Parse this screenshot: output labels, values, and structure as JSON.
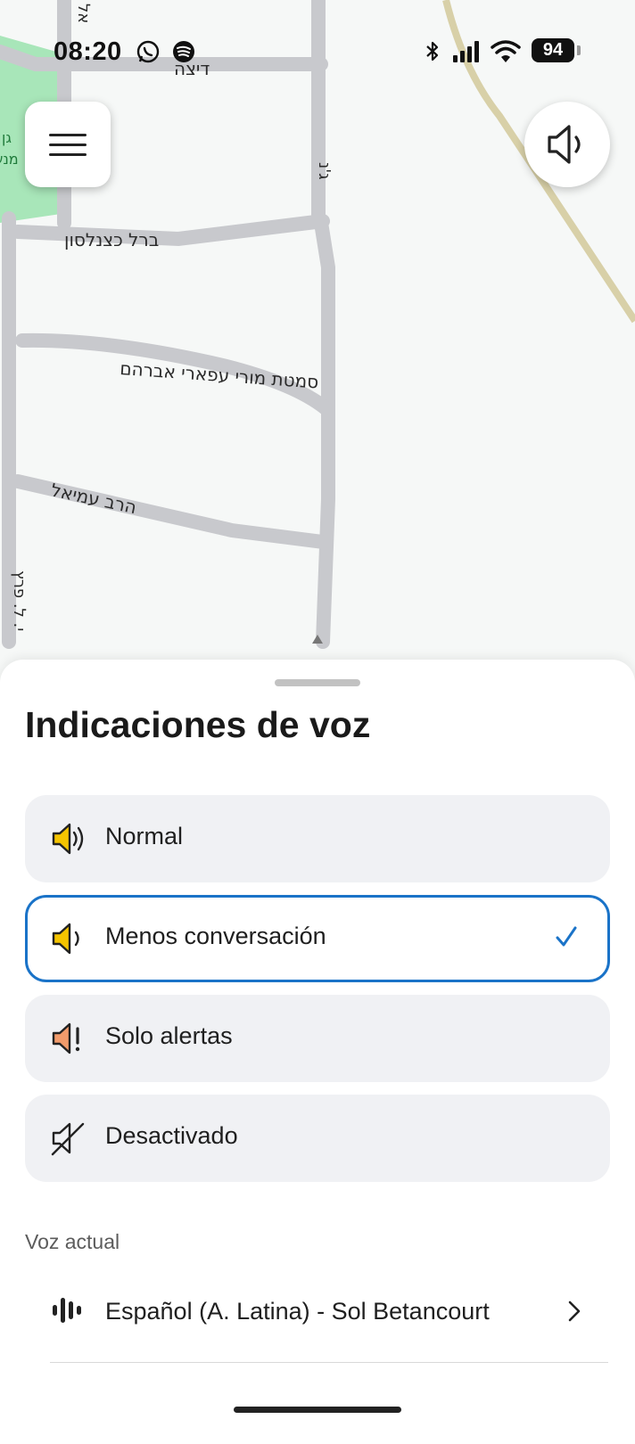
{
  "status_bar": {
    "time": "08:20",
    "battery": "94",
    "icons": [
      "whatsapp-icon",
      "spotify-icon",
      "bluetooth-icon",
      "cell-signal-icon",
      "wifi-icon",
      "battery-icon"
    ]
  },
  "map": {
    "streets": [
      "דיצה",
      "ברל כצנלסון",
      "סמטת מורי עפארי אברהם",
      "הרב עמיאל",
      "ג'נ",
      "אל",
      "י. ל. פרץ"
    ],
    "park_label": [
      "גן",
      "מנש"
    ]
  },
  "controls": {
    "menu_icon": "hamburger-menu-icon",
    "sound_icon": "speaker-reduced-icon"
  },
  "sheet": {
    "title": "Indicaciones de voz",
    "options": [
      {
        "label": "Normal",
        "icon": "speaker-full-icon",
        "selected": false
      },
      {
        "label": "Menos conversación",
        "icon": "speaker-low-icon",
        "selected": true
      },
      {
        "label": "Solo alertas",
        "icon": "speaker-alert-icon",
        "selected": false
      },
      {
        "label": "Desactivado",
        "icon": "speaker-muted-icon",
        "selected": false
      }
    ],
    "current_voice_label": "Voz actual",
    "current_voice": "Español (A. Latina) - Sol Betancourt"
  },
  "colors": {
    "accent": "#1a73c8",
    "speaker_yellow": "#f5c400",
    "speaker_orange": "#f29b6b",
    "park_green": "#a8e6b9",
    "railway": "#d8d0a8"
  }
}
